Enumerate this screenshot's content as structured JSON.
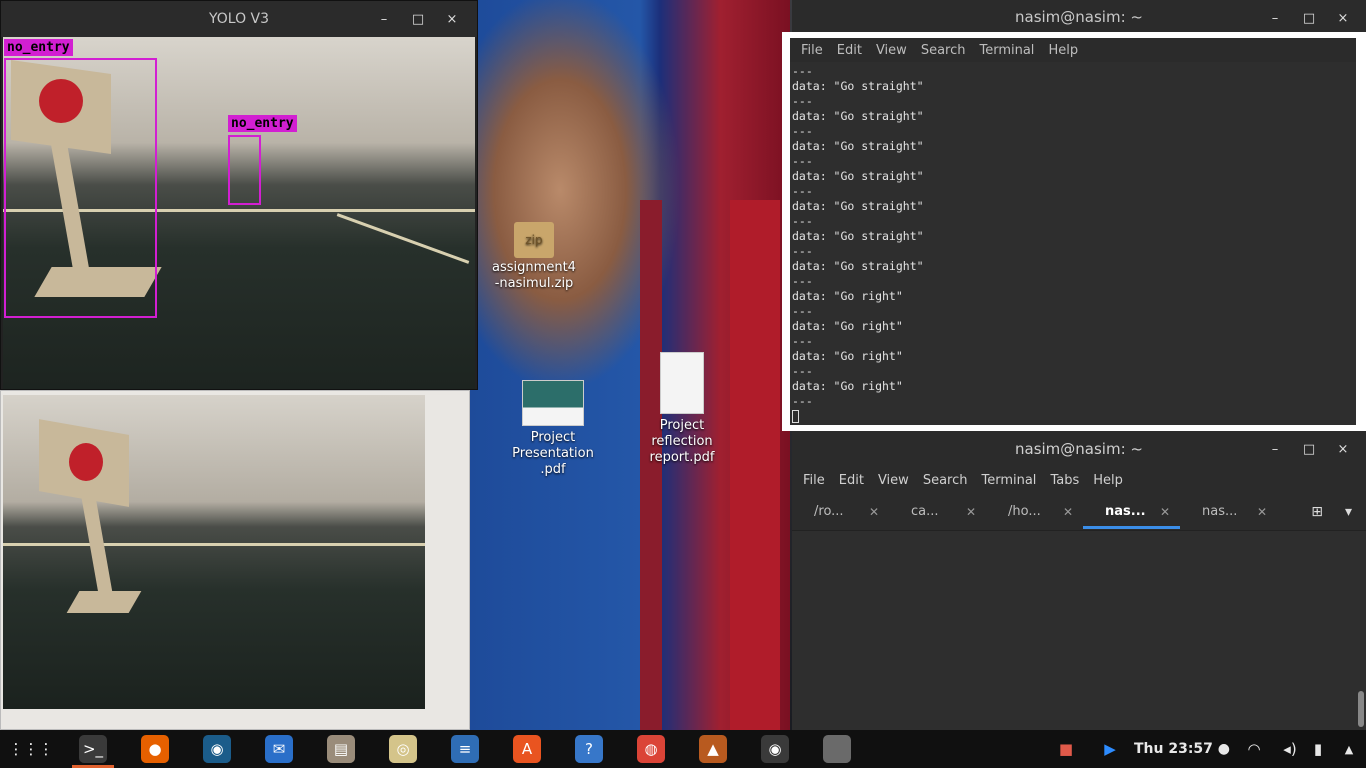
{
  "yolo_window": {
    "title": "YOLO V3",
    "controls": {
      "minimize": "–",
      "maximize": "□",
      "close": "×"
    },
    "detections": [
      {
        "label": "no_entry"
      },
      {
        "label": "no_entry"
      }
    ]
  },
  "desktop_icons": [
    {
      "name": "assignment4\n-nasimul.zip",
      "badge": "zip"
    },
    {
      "name": "Project\nPresentation\n.pdf"
    },
    {
      "name": "Project\nreflection\nreport.pdf"
    }
  ],
  "terminal1": {
    "title": "nasim@nasim: ~",
    "menu": [
      "File",
      "Edit",
      "View",
      "Search",
      "Terminal",
      "Help"
    ],
    "lines": [
      "---",
      "data: \"Go straight\"",
      "---",
      "data: \"Go straight\"",
      "---",
      "data: \"Go straight\"",
      "---",
      "data: \"Go straight\"",
      "---",
      "data: \"Go straight\"",
      "---",
      "data: \"Go straight\"",
      "---",
      "data: \"Go straight\"",
      "---",
      "data: \"Go right\"",
      "---",
      "data: \"Go right\"",
      "---",
      "data: \"Go right\"",
      "---",
      "data: \"Go right\"",
      "---"
    ]
  },
  "terminal2": {
    "title": "nasim@nasim: ~",
    "menu": [
      "File",
      "Edit",
      "View",
      "Search",
      "Terminal",
      "Tabs",
      "Help"
    ],
    "tabs": [
      {
        "label": "/ro...",
        "active": false
      },
      {
        "label": "ca...",
        "active": false
      },
      {
        "label": "/ho...",
        "active": false
      },
      {
        "label": "nas...",
        "active": true
      },
      {
        "label": "nas...",
        "active": false
      }
    ]
  },
  "taskbar": {
    "apps": [
      {
        "name": "app-grid-icon",
        "glyph": "⋮⋮⋮",
        "color": "#101010"
      },
      {
        "name": "terminal-icon",
        "glyph": ">_",
        "color": "#3a3a3a",
        "active": true
      },
      {
        "name": "firefox-icon",
        "glyph": "●",
        "color": "#e66000"
      },
      {
        "name": "steam-icon",
        "glyph": "◉",
        "color": "#1b5c8a"
      },
      {
        "name": "thunderbird-icon",
        "glyph": "✉",
        "color": "#2a6fc9"
      },
      {
        "name": "file-manager-icon",
        "glyph": "▤",
        "color": "#9a8c7a"
      },
      {
        "name": "rhythmbox-icon",
        "glyph": "◎",
        "color": "#d4c48a"
      },
      {
        "name": "text-editor-icon",
        "glyph": "≡",
        "color": "#2f6db5"
      },
      {
        "name": "software-center-icon",
        "glyph": "A",
        "color": "#e95420"
      },
      {
        "name": "help-icon",
        "glyph": "?",
        "color": "#3777c9"
      },
      {
        "name": "chrome-icon",
        "glyph": "◍",
        "color": "#db4437"
      },
      {
        "name": "matlab-icon",
        "glyph": "▲",
        "color": "#b85a1f"
      },
      {
        "name": "screen-recorder-icon",
        "glyph": "◉",
        "color": "#3a3a3a"
      },
      {
        "name": "blank-window-icon",
        "glyph": "",
        "color": "#6a6a6a"
      }
    ],
    "tray": {
      "camera": "■",
      "zoom": "▶",
      "clock": "Thu 23:57 ●",
      "wifi": "◠",
      "volume": "◂)",
      "battery": "▮",
      "menu": "▲"
    }
  }
}
